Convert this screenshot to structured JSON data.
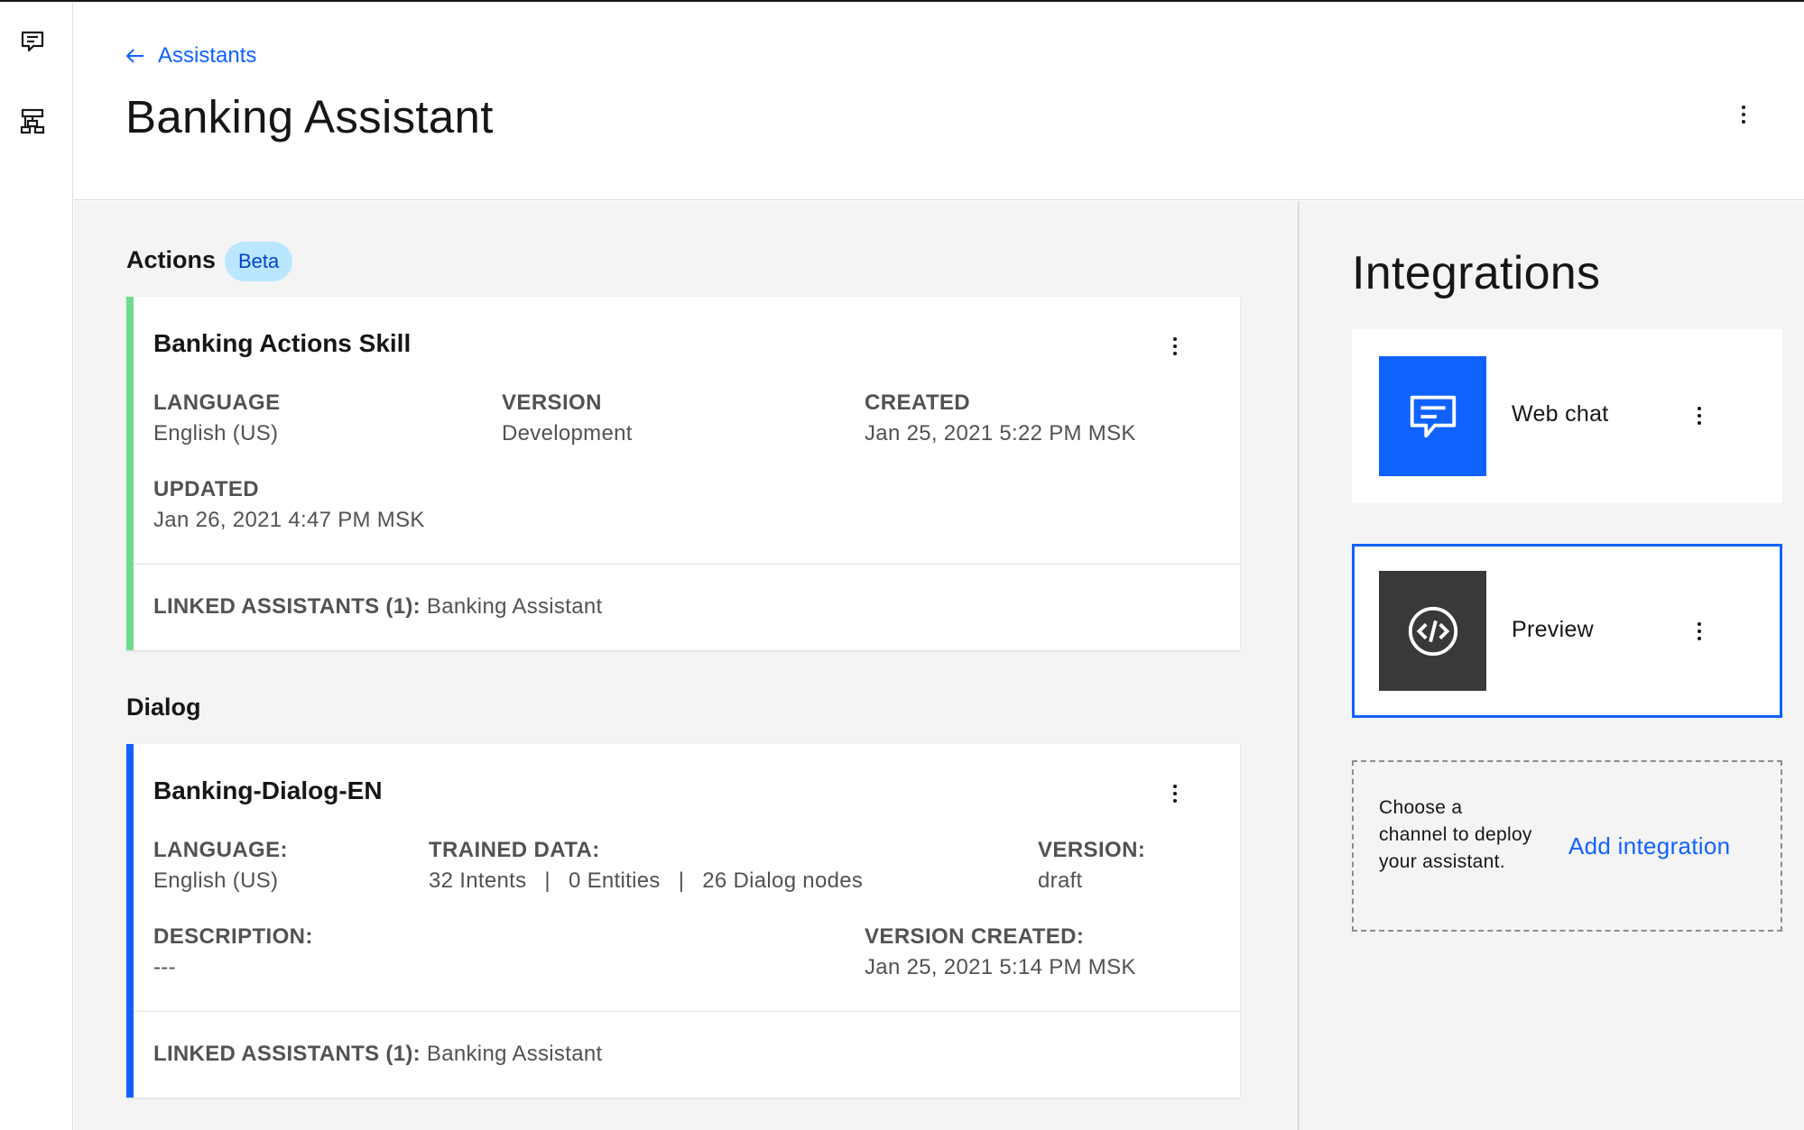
{
  "nav": {
    "back_label": "Assistants",
    "page_title": "Banking Assistant"
  },
  "actions_section": {
    "title": "Actions",
    "tag": "Beta",
    "accent_color": "#6fdc8c",
    "card": {
      "name": "Banking Actions Skill",
      "language_label": "LANGUAGE",
      "language_value": "English (US)",
      "version_label": "VERSION",
      "version_value": "Development",
      "created_label": "CREATED",
      "created_value": "Jan 25, 2021 5:22 PM MSK",
      "updated_label": "UPDATED",
      "updated_value": "Jan 26, 2021 4:47 PM MSK",
      "linked_label": "LINKED ASSISTANTS (1):",
      "linked_value": "Banking Assistant"
    }
  },
  "dialog_section": {
    "title": "Dialog",
    "accent_color": "#0f62fe",
    "card": {
      "name": "Banking-Dialog-EN",
      "language_label": "LANGUAGE:",
      "language_value": "English (US)",
      "trained_label": "TRAINED DATA:",
      "intents": "32 Intents",
      "entities": "0 Entities",
      "dialog_nodes": "26 Dialog nodes",
      "separator": "|",
      "version_label": "VERSION:",
      "version_value": "draft",
      "description_label": "DESCRIPTION:",
      "description_value": "---",
      "version_created_label": "VERSION CREATED:",
      "version_created_value": "Jan 25, 2021 5:14 PM MSK",
      "linked_label": "LINKED ASSISTANTS (1):",
      "linked_value": "Banking Assistant"
    }
  },
  "integrations": {
    "title": "Integrations",
    "items": [
      {
        "label": "Web chat",
        "icon": "chat-icon",
        "icon_bg": "#0f62fe"
      },
      {
        "label": "Preview",
        "icon": "code-icon",
        "icon_bg": "#393939",
        "selected": true
      }
    ],
    "add_text": "Choose a channel to deploy your assistant.",
    "add_link": "Add integration"
  }
}
